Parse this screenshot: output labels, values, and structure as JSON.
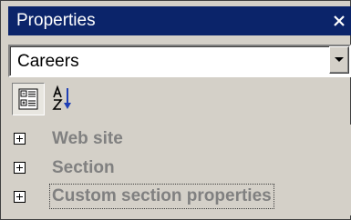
{
  "panel": {
    "title": "Properties",
    "close_glyph": "×"
  },
  "object_selector": {
    "value": "Careers"
  },
  "toolbar": {
    "buttons": [
      {
        "name": "categorized-icon",
        "pressed": true
      },
      {
        "name": "alphabetical-sort-icon",
        "pressed": false
      }
    ]
  },
  "categories": [
    {
      "label": "Web site",
      "expanded": false
    },
    {
      "label": "Section",
      "expanded": false
    },
    {
      "label": "Custom section properties",
      "expanded": false,
      "focused": true
    }
  ],
  "colors": {
    "title_bar": "#0b246a",
    "panel_bg": "#d4d0c8",
    "category_text": "#808080",
    "sort_arrow": "#1f3fb5"
  }
}
